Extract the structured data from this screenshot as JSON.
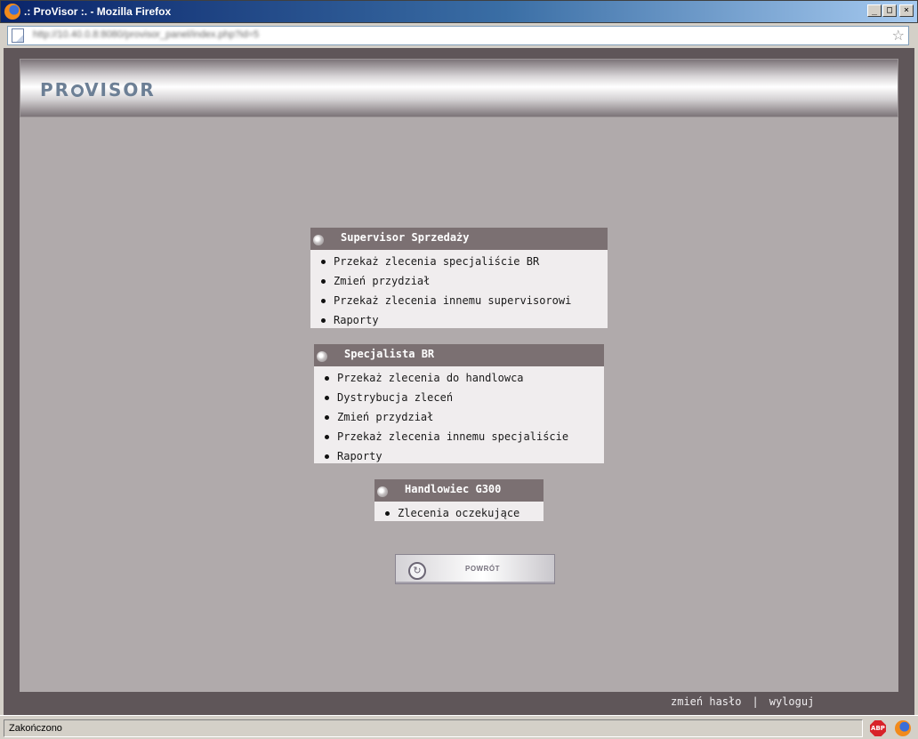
{
  "window": {
    "title": ".: ProVisor :. - Mozilla Firefox",
    "btn_min": "_",
    "btn_max": "□",
    "btn_close": "×"
  },
  "address": {
    "url": "http://10.40.0.8:8080/provisor_panel/index.php?id=5"
  },
  "header": {
    "logo_pre": "PR",
    "logo_post": "VISOR"
  },
  "panels": [
    {
      "title": "Supervisor Sprzedaży",
      "items": [
        "Przekaż zlecenia specjaliście BR",
        "Zmień przydział",
        "Przekaż zlecenia innemu supervisorowi",
        "Raporty"
      ]
    },
    {
      "title": "Specjalista BR",
      "items": [
        "Przekaż zlecenia do handlowca",
        "Dystrybucja zleceń",
        "Zmień przydział",
        "Przekaż zlecenia innemu specjaliście",
        "Raporty"
      ]
    },
    {
      "title": "Handlowiec G300",
      "items": [
        "Zlecenia oczekujące"
      ]
    }
  ],
  "back_button": {
    "label": "POWRÓT"
  },
  "footer": {
    "change_password": "zmień hasło",
    "separator": "|",
    "logout": "wyloguj"
  },
  "status": {
    "text": "Zakończono",
    "abp": "ABP"
  },
  "colors": {
    "panel_header": "#7b7072",
    "content_bg": "#b0aaab",
    "frame_bg": "#5f5659"
  }
}
